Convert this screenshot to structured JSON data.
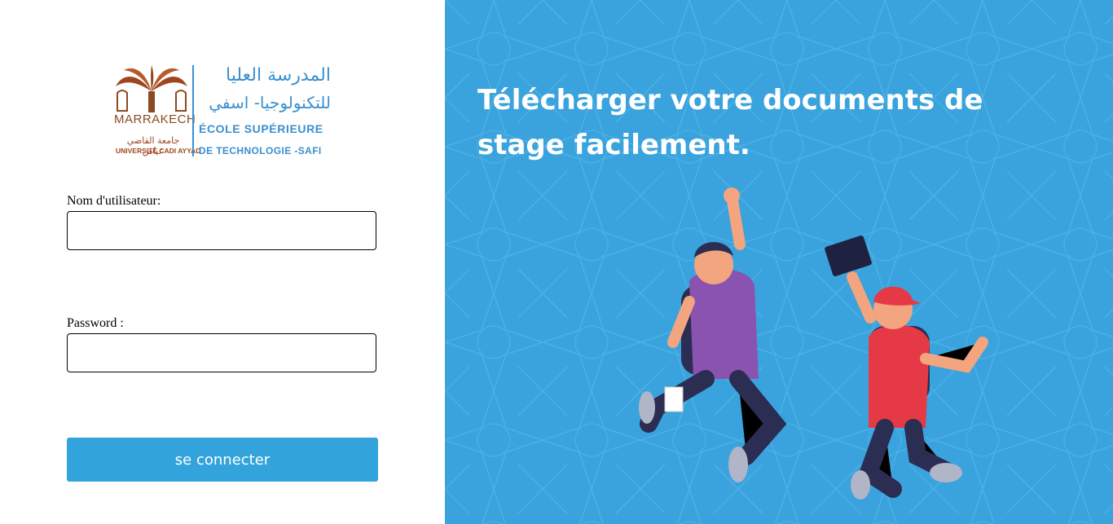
{
  "logo": {
    "city": "MARRAKECH",
    "arabic_university": "جامعة القاضي عياض",
    "university": "UNIVERSITÉ CADI AYYAD",
    "arabic_line1": "المدرسة العليا",
    "arabic_line2": "للتكنولوجيا- اسفي",
    "french_line1": "ÉCOLE SUPÉRIEURE",
    "french_line2": "DE TECHNOLOGIE -SAFI"
  },
  "form": {
    "username_label": "Nom d'utilisateur:",
    "username_value": "",
    "password_label": "Password :",
    "password_value": "",
    "submit_label": "se connecter"
  },
  "hero": {
    "headline": "Télécharger votre documents de stage facilement."
  },
  "colors": {
    "accent": "#33a3dc",
    "panel": "#3aa3dd",
    "logo_blue": "#3a8fd0",
    "logo_brown": "#a0461e"
  }
}
